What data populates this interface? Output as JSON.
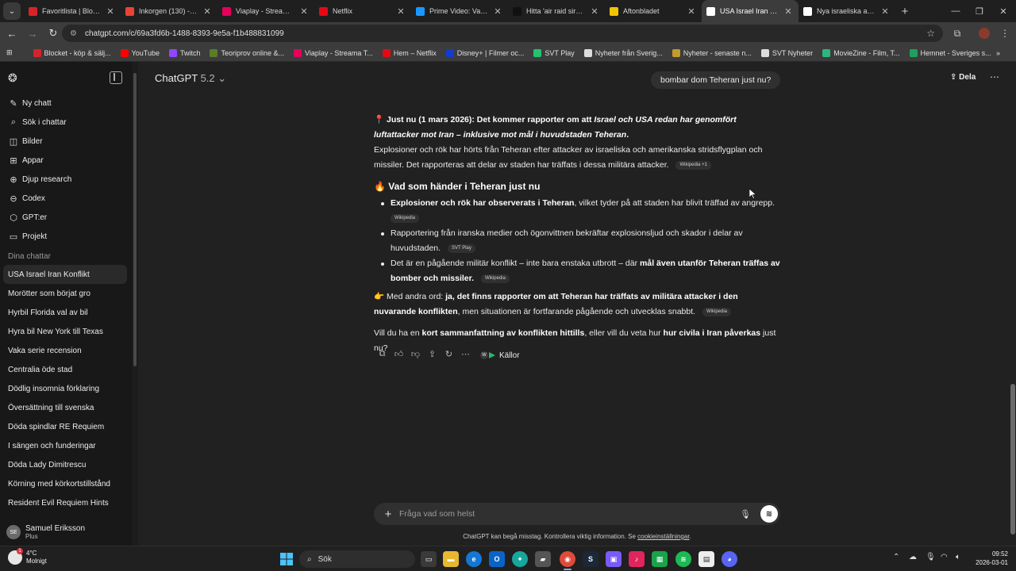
{
  "browser": {
    "tabs": [
      {
        "title": "Favoritlista | Blocket",
        "icon": "blocket-icon",
        "color": "#d8232a"
      },
      {
        "title": "Inkorgen (130) - sam",
        "icon": "gmail-icon",
        "color": "#ea4335"
      },
      {
        "title": "Viaplay - Streama TV",
        "icon": "viaplay-icon",
        "color": "#e6005c"
      },
      {
        "title": "Netflix",
        "icon": "netflix-icon",
        "color": "#e50914"
      },
      {
        "title": "Prime Video: Vaka- S",
        "icon": "prime-video-icon",
        "color": "#1a98ff"
      },
      {
        "title": "Hitta 'air raid siren b",
        "icon": "tiktok-icon",
        "color": "#111111"
      },
      {
        "title": "Aftonbladet",
        "icon": "aftonbladet-icon",
        "color": "#f5c400"
      },
      {
        "title": "USA Israel Iran Konfli",
        "icon": "chatgpt-icon",
        "color": "#ffffff"
      },
      {
        "title": "Nya israeliska anfall",
        "icon": "svt-icon",
        "color": "#ffffff"
      }
    ],
    "url": "chatgpt.com/c/69a3fd6b-1488-8393-9e5a-f1b488831099",
    "bookmarks": [
      {
        "label": "Blocket - köp & sälj...",
        "icon": "blocket-icon",
        "color": "#d8232a"
      },
      {
        "label": "YouTube",
        "icon": "youtube-icon",
        "color": "#ff0000"
      },
      {
        "label": "Twitch",
        "icon": "twitch-icon",
        "color": "#9146ff"
      },
      {
        "label": "Teoriprov online &...",
        "icon": "teoriprov-icon",
        "color": "#5a7d2a"
      },
      {
        "label": "Viaplay - Streama T...",
        "icon": "viaplay-icon",
        "color": "#e6005c"
      },
      {
        "label": "Hem – Netflix",
        "icon": "netflix-icon",
        "color": "#e50914"
      },
      {
        "label": "Disney+ | Filmer oc...",
        "icon": "disney-icon",
        "color": "#113ccf"
      },
      {
        "label": "SVT Play",
        "icon": "svtplay-icon",
        "color": "#25c26e"
      },
      {
        "label": "Nyheter från Sverig...",
        "icon": "news-icon",
        "color": "#dddddd"
      },
      {
        "label": "Nyheter - senaste n...",
        "icon": "news2-icon",
        "color": "#c59a2c"
      },
      {
        "label": "SVT Nyheter",
        "icon": "svt-icon",
        "color": "#dddddd"
      },
      {
        "label": "MovieZine - Film, T...",
        "icon": "moviezine-icon",
        "color": "#2cb67d"
      },
      {
        "label": "Hemnet - Sveriges s...",
        "icon": "hemnet-icon",
        "color": "#21a05c"
      }
    ]
  },
  "sidebar": {
    "nav": [
      {
        "label": "Ny chatt",
        "icon": "compose-icon",
        "glyph": "✎"
      },
      {
        "label": "Sök i chattar",
        "icon": "search-icon",
        "glyph": "⌕"
      },
      {
        "label": "Bilder",
        "icon": "images-icon",
        "glyph": "◫"
      },
      {
        "label": "Appar",
        "icon": "apps-icon",
        "glyph": "⊞"
      },
      {
        "label": "Djup research",
        "icon": "research-icon",
        "glyph": "⊕"
      },
      {
        "label": "Codex",
        "icon": "codex-icon",
        "glyph": "⊖"
      },
      {
        "label": "GPT:er",
        "icon": "gpts-icon",
        "glyph": "⬡"
      },
      {
        "label": "Projekt",
        "icon": "folder-icon",
        "glyph": "▭"
      }
    ],
    "section_title": "Dina chattar",
    "chats": [
      "USA Israel Iran Konflikt",
      "Morötter som börjat gro",
      "Hyrbil Florida val av bil",
      "Hyra bil New York till Texas",
      "Vaka serie recension",
      "Centralia öde stad",
      "Dödlig insomnia förklaring",
      "Översättning till svenska",
      "Döda spindlar RE Requiem",
      "I sängen och funderingar",
      "Döda Lady Dimitrescu",
      "Körning med körkortstillstånd",
      "Resident Evil Requiem Hints"
    ],
    "user": {
      "initials": "SE",
      "name": "Samuel Eriksson",
      "plan": "Plus"
    }
  },
  "header": {
    "model": "ChatGPT",
    "version": "5.2",
    "share": "Dela"
  },
  "conversation": {
    "user_message": "bombar dom Teheran just nu?",
    "intro_emoji": "📍",
    "intro_bold": "Just nu (1 mars 2026): Det kommer rapporter om att ",
    "intro_italic": "Israel och USA redan har genomfört luftattacker mot Iran – inklusive mot mål i huvudstaden Teheran",
    "intro_end": ".",
    "para2": "Explosioner och rök har hörts från Teheran efter attacker av israeliska och amerikanska stridsflygplan och missiler. Det rapporteras att delar av staden har träffats i dessa militära attacker.",
    "chip1": "Wikipedia +1",
    "heading_emoji": "🔥",
    "heading": "Vad som händer i Teheran just nu",
    "bullet1_bold": "Explosioner och rök har observerats i Teheran",
    "bullet1_rest": ", vilket tyder på att staden har blivit träffad av angrepp.",
    "bullet1_chip": "Wikipedia",
    "bullet2": "Rapportering från iranska medier och ögonvittnen bekräftar explosionsljud och skador i delar av huvudstaden.",
    "bullet2_chip": "SVT Play",
    "bullet3_start": "Det är en pågående militär konflikt – inte bara enstaka utbrott – där ",
    "bullet3_bold": "mål även utanför Teheran träffas av bomber och missiler.",
    "bullet3_chip": "Wikipedia",
    "summary_emoji": "👉",
    "summary_start": " Med andra ord: ",
    "summary_bold": "ja, det finns rapporter om att Teheran har träffats av militära attacker i den nuvarande konflikten",
    "summary_end": ", men situationen är fortfarande pågående och utvecklas snabbt.",
    "summary_chip": "Wikipedia",
    "question_start": "Vill du ha en ",
    "question_bold1": "kort sammanfattning av konflikten hittills",
    "question_mid": ", eller vill du veta hur ",
    "question_bold2": "hur civila i Iran påverkas",
    "question_end": " just nu?",
    "sources_label": "Källor"
  },
  "composer": {
    "placeholder": "Fråga vad som helst",
    "disclaimer": "ChatGPT kan begå misstag. Kontrollera viktig information. Se ",
    "disclaimer_link": "cookieinställningar",
    "disclaimer_end": "."
  },
  "taskbar": {
    "temperature": "4°C",
    "weather": "Molnigt",
    "search": "Sök",
    "time": "09:52",
    "date": "2026-03-01"
  }
}
